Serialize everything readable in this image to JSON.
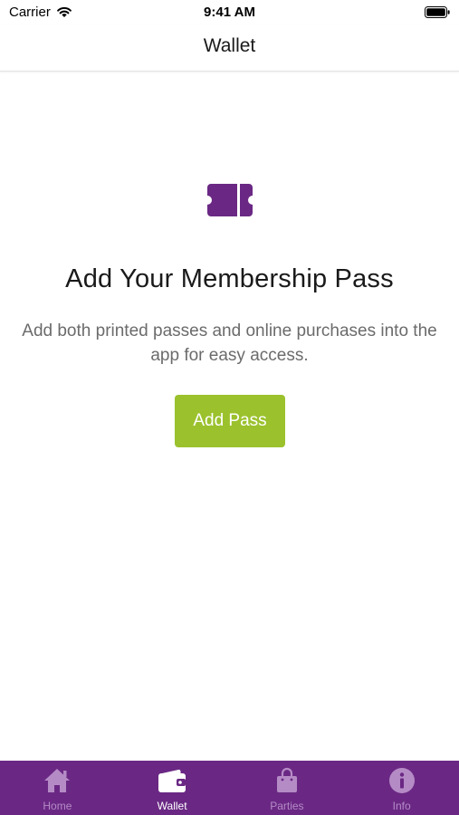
{
  "status_bar": {
    "carrier": "Carrier",
    "time": "9:41 AM"
  },
  "nav": {
    "title": "Wallet"
  },
  "empty_state": {
    "icon": "ticket-icon",
    "headline": "Add Your Membership Pass",
    "description": "Add both printed passes and online purchases into the app for easy access.",
    "button_label": "Add Pass"
  },
  "tab_bar": {
    "active_tab": "Wallet",
    "items": [
      {
        "label": "Home",
        "icon": "house-icon"
      },
      {
        "label": "Wallet",
        "icon": "wallet-icon"
      },
      {
        "label": "Parties",
        "icon": "shopping-bag-icon"
      },
      {
        "label": "Info",
        "icon": "info-icon"
      }
    ]
  },
  "colors": {
    "brand_purple": "#6a2884",
    "accent_green": "#9bc22d",
    "inactive_tab": "#b58bc6",
    "active_tab": "#ffffff"
  }
}
